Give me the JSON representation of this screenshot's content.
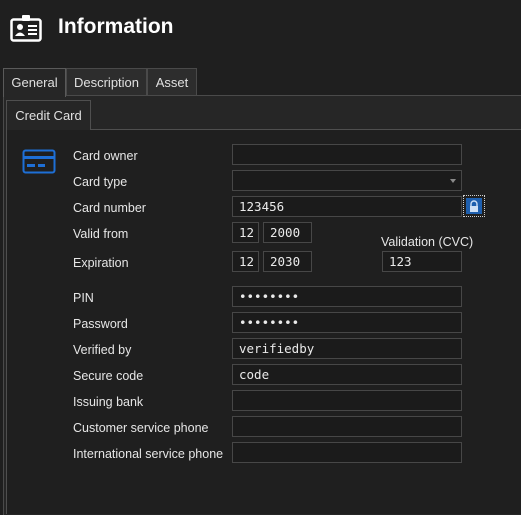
{
  "header": {
    "title": "Information",
    "icon": "id-card-icon"
  },
  "tabs": [
    {
      "label": "General",
      "active": true
    },
    {
      "label": "Description",
      "active": false
    },
    {
      "label": "Asset",
      "active": false
    }
  ],
  "subtabs": [
    {
      "label": "Credit Card",
      "active": true
    }
  ],
  "form": {
    "card_owner": {
      "label": "Card owner",
      "value": ""
    },
    "card_type": {
      "label": "Card type",
      "value": ""
    },
    "card_number": {
      "label": "Card number",
      "value": "123456"
    },
    "valid_from": {
      "label": "Valid from",
      "month": "12",
      "year": "2000"
    },
    "expiration": {
      "label": "Expiration",
      "month": "12",
      "year": "2030"
    },
    "cvc": {
      "label": "Validation (CVC)",
      "value": "123"
    },
    "pin": {
      "label": "PIN",
      "value": "••••••••"
    },
    "password": {
      "label": "Password",
      "value": "••••••••"
    },
    "verified_by": {
      "label": "Verified by",
      "value": "verifiedby"
    },
    "secure_code": {
      "label": "Secure code",
      "value": "code"
    },
    "issuing_bank": {
      "label": "Issuing bank",
      "value": ""
    },
    "customer_service_phone": {
      "label": "Customer service phone",
      "value": ""
    },
    "international_service_phone": {
      "label": "International service phone",
      "value": ""
    }
  },
  "colors": {
    "accent": "#1e5fae",
    "background": "#1f1f1f",
    "field_border": "#474747"
  }
}
